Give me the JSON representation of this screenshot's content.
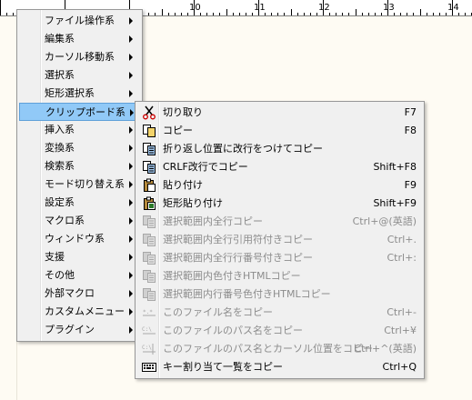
{
  "ruler": {
    "labels": [
      "10",
      "11",
      "12",
      "13",
      "14"
    ]
  },
  "main_menu": {
    "items": [
      {
        "label": "ファイル操作系"
      },
      {
        "label": "編集系"
      },
      {
        "label": "カーソル移動系"
      },
      {
        "label": "選択系"
      },
      {
        "label": "矩形選択系"
      },
      {
        "label": "クリップボード系",
        "selected": true
      },
      {
        "label": "挿入系"
      },
      {
        "label": "変換系"
      },
      {
        "label": "検索系"
      },
      {
        "label": "モード切り替え系"
      },
      {
        "label": "設定系"
      },
      {
        "label": "マクロ系"
      },
      {
        "label": "ウィンドウ系"
      },
      {
        "label": "支援"
      },
      {
        "label": "その他"
      },
      {
        "label": "外部マクロ"
      },
      {
        "label": "カスタムメニュー"
      },
      {
        "label": "プラグイン"
      }
    ]
  },
  "clipboard_menu": {
    "items": [
      {
        "icon": "scissors-icon",
        "label": "切り取り",
        "shortcut": "F7",
        "enabled": true
      },
      {
        "icon": "copy-icon",
        "label": "コピー",
        "shortcut": "F8",
        "enabled": true
      },
      {
        "icon": "copy-wrap-icon",
        "label": "折り返し位置に改行をつけてコピー",
        "shortcut": "",
        "enabled": true
      },
      {
        "icon": "copy-crlf-icon",
        "label": "CRLF改行でコピー",
        "shortcut": "Shift+F8",
        "enabled": true
      },
      {
        "icon": "paste-icon",
        "label": "貼り付け",
        "shortcut": "F9",
        "enabled": true
      },
      {
        "icon": "paste-box-icon",
        "label": "矩形貼り付け",
        "shortcut": "Shift+F9",
        "enabled": true
      },
      {
        "icon": "copy-all-icon",
        "label": "選択範囲内全行コピー",
        "shortcut": "Ctrl+@(英語)",
        "enabled": false
      },
      {
        "icon": "copy-quote-icon",
        "label": "選択範囲内全行引用符付きコピー",
        "shortcut": "Ctrl+.",
        "enabled": false
      },
      {
        "icon": "copy-linenum-icon",
        "label": "選択範囲内全行行番号付きコピー",
        "shortcut": "Ctrl+:",
        "enabled": false
      },
      {
        "icon": "copy-html-icon",
        "label": "選択範囲内色付きHTMLコピー",
        "shortcut": "",
        "enabled": false
      },
      {
        "icon": "copy-html-linenum-icon",
        "label": "選択範囲内行番号色付きHTMLコピー",
        "shortcut": "",
        "enabled": false
      },
      {
        "icon": "filename-icon",
        "label": "このファイル名をコピー",
        "shortcut": "Ctrl+-",
        "enabled": false
      },
      {
        "icon": "filepath-icon",
        "label": "このファイルのパス名をコピー",
        "shortcut": "Ctrl+¥",
        "enabled": false
      },
      {
        "icon": "filepath-cursor-icon",
        "label": "このファイルのパス名とカーソル位置をコピー",
        "shortcut": "Ctrl+^(英語)",
        "enabled": false
      },
      {
        "icon": "keyboard-icon",
        "label": "キー割り当て一覧をコピー",
        "shortcut": "Ctrl+Q",
        "enabled": true
      }
    ]
  }
}
